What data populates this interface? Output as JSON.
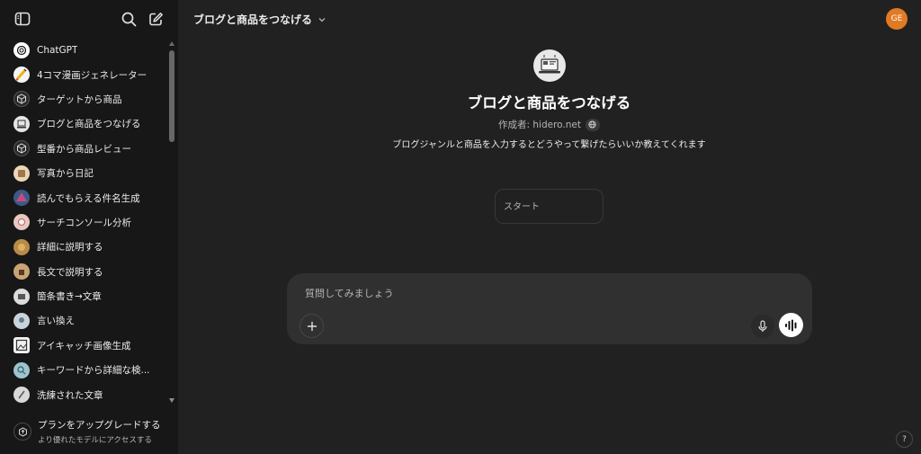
{
  "sidebar": {
    "items": [
      {
        "label": "ChatGPT",
        "icon": "openai-icon"
      },
      {
        "label": "4コマ漫画ジェネレーター",
        "icon": "comic-avatar"
      },
      {
        "label": "ターゲットから商品",
        "icon": "cube-icon"
      },
      {
        "label": "ブログと商品をつなげる",
        "icon": "laptop-avatar"
      },
      {
        "label": "型番から商品レビュー",
        "icon": "cube-icon"
      },
      {
        "label": "写真から日記",
        "icon": "photo-avatar"
      },
      {
        "label": "読んでもらえる件名生成",
        "icon": "mail-avatar"
      },
      {
        "label": "サーチコンソール分析",
        "icon": "chart-avatar"
      },
      {
        "label": "詳細に説明する",
        "icon": "lion-avatar"
      },
      {
        "label": "長文で説明する",
        "icon": "writer-avatar"
      },
      {
        "label": "箇条書き→文章",
        "icon": "list-avatar"
      },
      {
        "label": "言い換え",
        "icon": "swap-avatar"
      },
      {
        "label": "アイキャッチ画像生成",
        "icon": "image-avatar"
      },
      {
        "label": "キーワードから詳細な検...",
        "icon": "search-avatar"
      },
      {
        "label": "洗練された文章",
        "icon": "pen-avatar"
      }
    ],
    "upgrade": {
      "title": "プランをアップグレードする",
      "subtitle": "より優れたモデルにアクセスする"
    }
  },
  "header": {
    "title": "ブログと商品をつなげる",
    "avatar_initials": "GE"
  },
  "gpt": {
    "name": "ブログと商品をつなげる",
    "author": "作成者: hidero.net",
    "description": "ブログジャンルと商品を入力するとどうやって繋げたらいいか教えてくれます",
    "starter": "スタート"
  },
  "composer": {
    "placeholder": "質問してみましょう"
  },
  "help_label": "?",
  "colors": {
    "background": "#212121",
    "sidebar": "#171717",
    "composer": "#303030",
    "avatar": "#e07a23"
  }
}
